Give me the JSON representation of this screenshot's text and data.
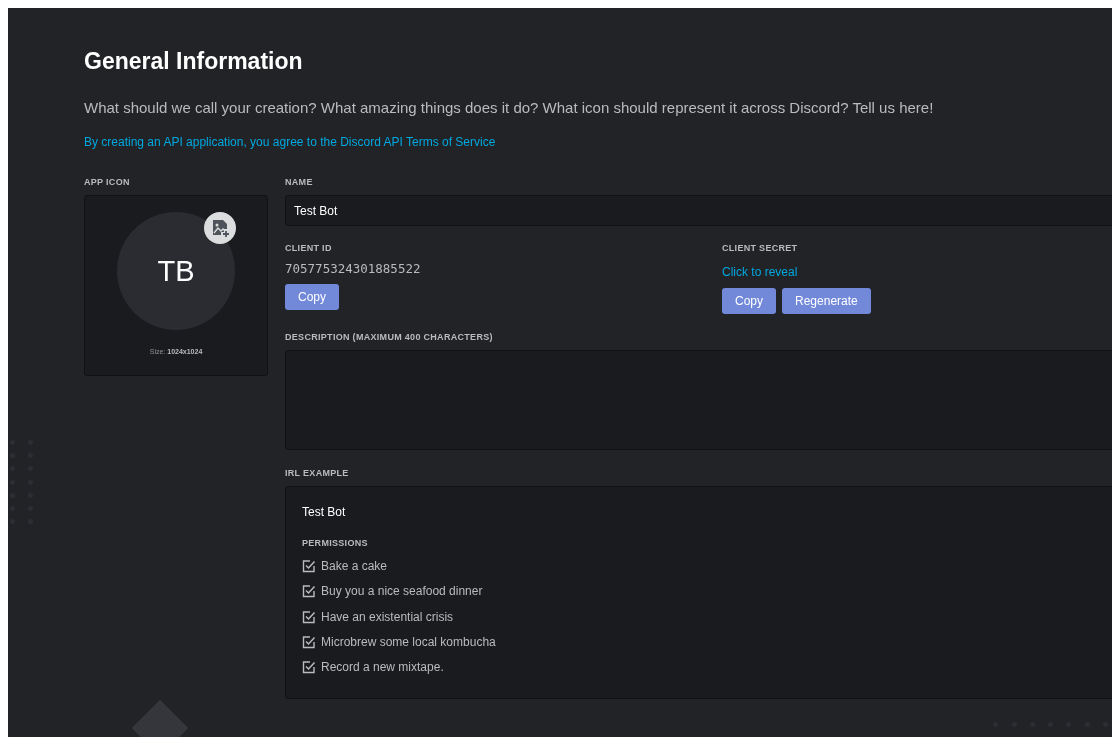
{
  "title": "General Information",
  "intro": "What should we call your creation? What amazing things does it do? What icon should represent it across Discord? Tell us here!",
  "terms_link": "By creating an API application, you agree to the Discord API Terms of Service",
  "app_icon": {
    "label": "APP ICON",
    "initials": "TB",
    "size_label": "Size:",
    "size_value": "1024x1024"
  },
  "name": {
    "label": "NAME",
    "value": "Test Bot"
  },
  "client_id": {
    "label": "CLIENT ID",
    "value": "705775324301885522",
    "buttons": [
      "Copy"
    ]
  },
  "client_secret": {
    "label": "CLIENT SECRET",
    "reveal": "Click to reveal",
    "buttons": [
      "Copy",
      "Regenerate"
    ]
  },
  "description": {
    "label": "DESCRIPTION (MAXIMUM 400 CHARACTERS)"
  },
  "irl_example": {
    "label": "IRL EXAMPLE",
    "bot_name": "Test Bot",
    "permissions_label": "PERMISSIONS",
    "permissions": [
      {
        "label": "Bake a cake",
        "checked": true
      },
      {
        "label": "Buy you a nice seafood dinner",
        "checked": true
      },
      {
        "label": "Have an existential crisis",
        "checked": true
      },
      {
        "label": "Microbrew some local kombucha",
        "checked": true
      },
      {
        "label": "Record a new mixtape.",
        "checked": true
      }
    ]
  }
}
